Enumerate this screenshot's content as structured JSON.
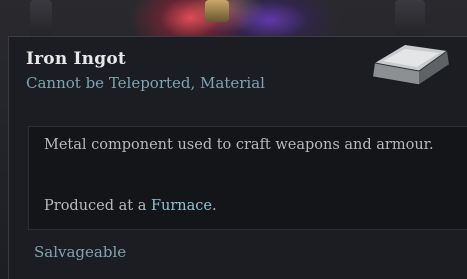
{
  "tooltip": {
    "item_name": "Iron Ingot",
    "subtitle": "Cannot be Teleported, Material",
    "icon": "iron-ingot-icon",
    "description": "Metal component used to craft weapons and armour.",
    "produced_prefix": "Produced at a ",
    "produced_link": "Furnace",
    "produced_suffix": ".",
    "salvage_label": "Salvageable"
  },
  "colors": {
    "name": "#e8e8ea",
    "subtitle": "#7fa3b3",
    "body_text": "#b8b9bd",
    "link": "#8fc1d6",
    "panel": "#1c1d22",
    "inner_panel": "#141519"
  }
}
